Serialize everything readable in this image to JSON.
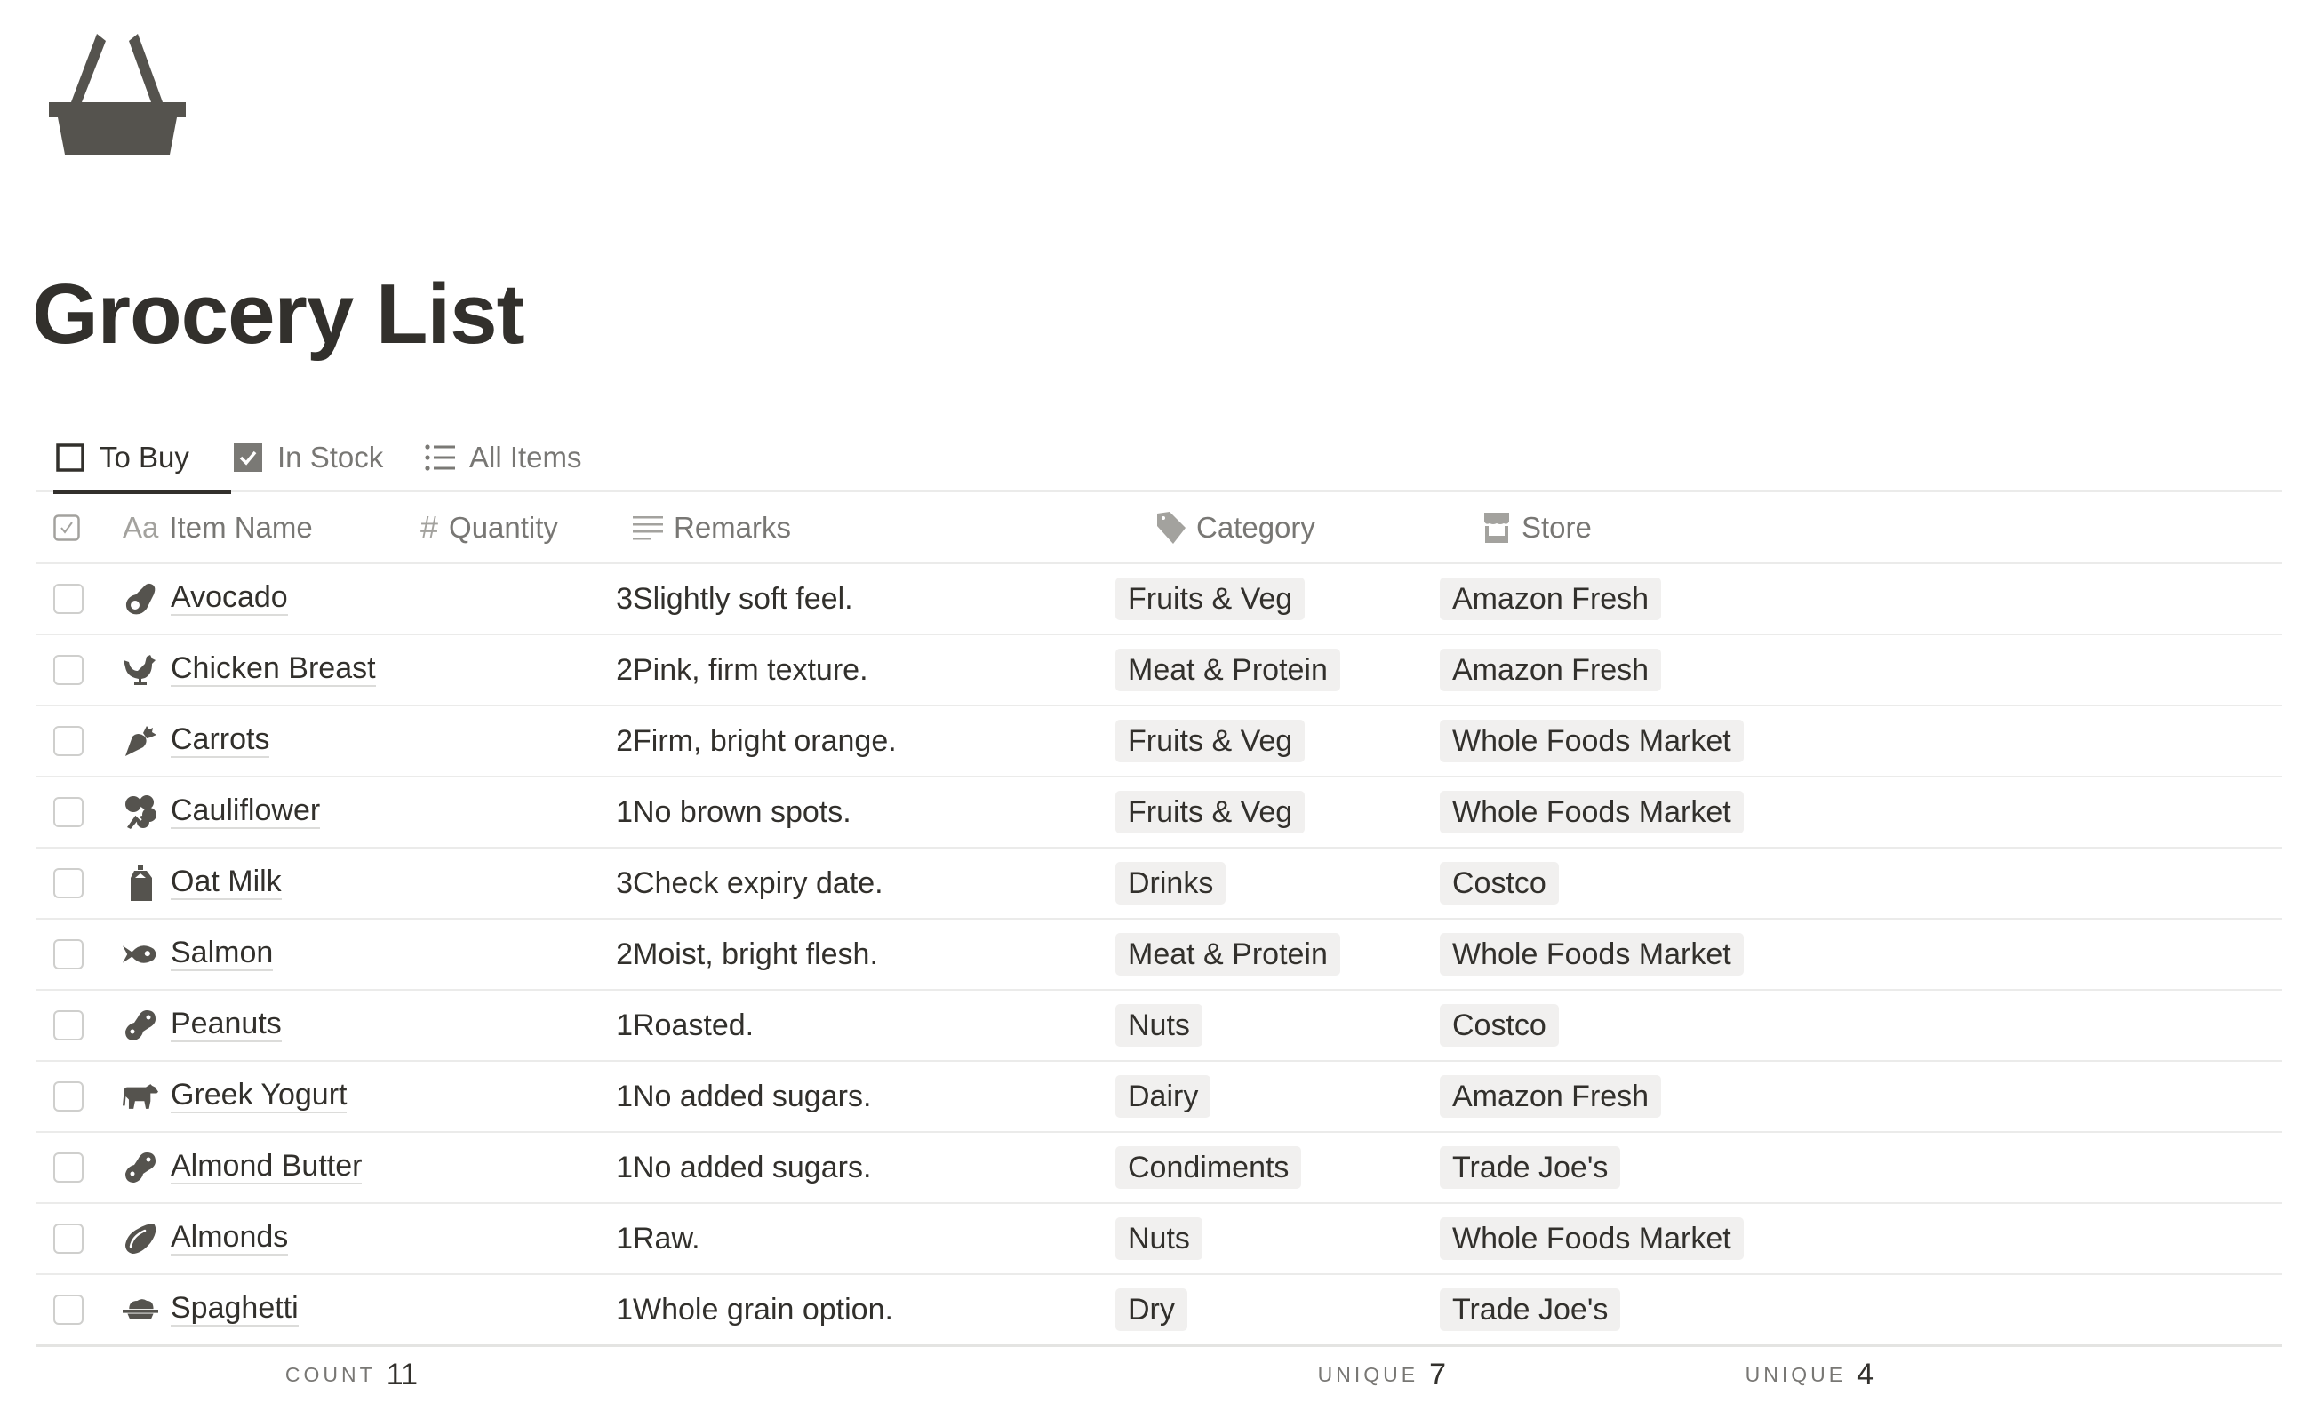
{
  "page": {
    "icon": "shopping-basket-icon",
    "title": "Grocery List"
  },
  "tabs": [
    {
      "label": "To Buy",
      "icon": "empty-checkbox-icon",
      "active": true
    },
    {
      "label": "In Stock",
      "icon": "checked-checkbox-icon",
      "active": false
    },
    {
      "label": "All Items",
      "icon": "list-icon",
      "active": false
    }
  ],
  "columns": {
    "done": {
      "icon": "checkbox-icon"
    },
    "name": {
      "label": "Item Name",
      "icon_text": "Aa"
    },
    "quantity": {
      "label": "Quantity",
      "icon_text": "#"
    },
    "remarks": {
      "label": "Remarks",
      "icon": "text-lines-icon"
    },
    "category": {
      "label": "Category",
      "icon": "tag-icon"
    },
    "store": {
      "label": "Store",
      "icon": "storefront-icon"
    }
  },
  "rows": [
    {
      "done": false,
      "icon": "avocado-icon",
      "name": "Avocado",
      "quantity": "3",
      "remarks": "Slightly soft feel.",
      "category": "Fruits & Veg",
      "store": "Amazon Fresh"
    },
    {
      "done": false,
      "icon": "chicken-icon",
      "name": "Chicken Breast",
      "quantity": "2",
      "remarks": "Pink, firm texture.",
      "category": "Meat & Protein",
      "store": "Amazon Fresh"
    },
    {
      "done": false,
      "icon": "carrot-icon",
      "name": "Carrots",
      "quantity": "2",
      "remarks": "Firm, bright orange.",
      "category": "Fruits & Veg",
      "store": "Whole Foods Market"
    },
    {
      "done": false,
      "icon": "cauliflower-icon",
      "name": "Cauliflower",
      "quantity": "1",
      "remarks": "No brown spots.",
      "category": "Fruits & Veg",
      "store": "Whole Foods Market"
    },
    {
      "done": false,
      "icon": "milk-carton-icon",
      "name": "Oat Milk",
      "quantity": "3",
      "remarks": "Check expiry date.",
      "category": "Drinks",
      "store": "Costco"
    },
    {
      "done": false,
      "icon": "fish-icon",
      "name": "Salmon",
      "quantity": "2",
      "remarks": "Moist, bright flesh.",
      "category": "Meat & Protein",
      "store": "Whole Foods Market"
    },
    {
      "done": false,
      "icon": "peanut-icon",
      "name": "Peanuts",
      "quantity": "1",
      "remarks": "Roasted.",
      "category": "Nuts",
      "store": "Costco"
    },
    {
      "done": false,
      "icon": "cow-icon",
      "name": "Greek Yogurt",
      "quantity": "1",
      "remarks": "No added sugars.",
      "category": "Dairy",
      "store": "Amazon Fresh"
    },
    {
      "done": false,
      "icon": "peanut-icon",
      "name": "Almond Butter",
      "quantity": "1",
      "remarks": "No added sugars.",
      "category": "Condiments",
      "store": "Trade Joe's"
    },
    {
      "done": false,
      "icon": "almond-icon",
      "name": "Almonds",
      "quantity": "1",
      "remarks": "Raw.",
      "category": "Nuts",
      "store": "Whole Foods Market"
    },
    {
      "done": false,
      "icon": "pasta-bowl-icon",
      "name": "Spaghetti",
      "quantity": "1",
      "remarks": "Whole grain option.",
      "category": "Dry",
      "store": "Trade Joe's"
    }
  ],
  "footer": {
    "name": {
      "label": "Count",
      "value": "11"
    },
    "category": {
      "label": "Unique",
      "value": "7"
    },
    "store": {
      "label": "Unique",
      "value": "4"
    }
  },
  "colors": {
    "text": "#32302c",
    "muted": "#787774",
    "icon": "#55534e",
    "tag_bg": "#f1f0ef",
    "divider": "#ebebea"
  }
}
